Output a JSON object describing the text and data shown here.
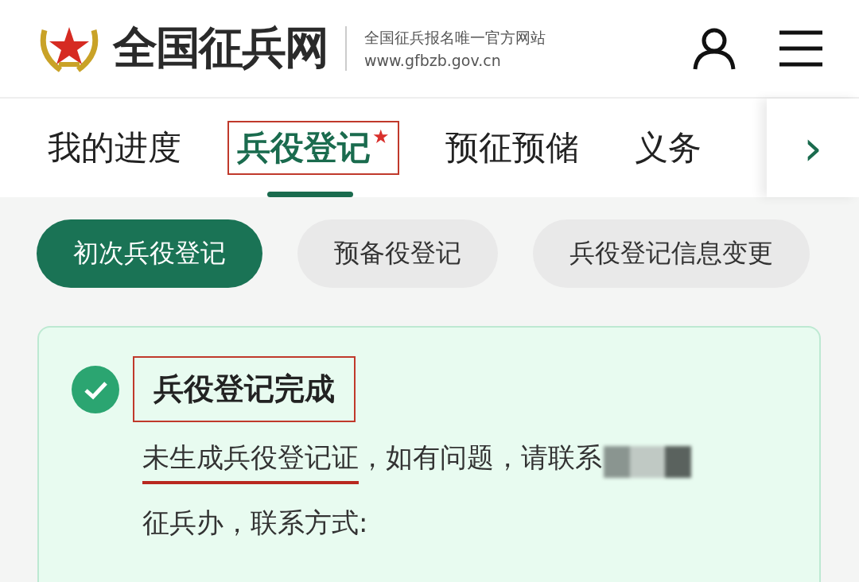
{
  "header": {
    "site_name": "全国征兵网",
    "tagline": "全国征兵报名唯一官方网站",
    "url": "www.gfbzb.gov.cn"
  },
  "tabs": [
    {
      "label": "我的进度",
      "selected": false,
      "starred": false,
      "annotated": false
    },
    {
      "label": "兵役登记",
      "selected": true,
      "starred": true,
      "annotated": true
    },
    {
      "label": "预征预储",
      "selected": false,
      "starred": false,
      "annotated": false
    },
    {
      "label": "义务",
      "selected": false,
      "starred": false,
      "annotated": false
    }
  ],
  "tab_star": "★",
  "tab_more": "›",
  "sub_tabs": [
    {
      "label": "初次兵役登记",
      "selected": true
    },
    {
      "label": "预备役登记",
      "selected": false
    },
    {
      "label": "兵役登记信息变更",
      "selected": false
    }
  ],
  "status_card": {
    "title": "兵役登记完成",
    "title_annotated": true,
    "lines": [
      {
        "parts": [
          {
            "text": "未生成兵役登记证",
            "underlined": true
          },
          {
            "text": "，如有问题，请联系",
            "underlined": false
          }
        ],
        "redacted": true
      },
      {
        "parts": [
          {
            "text": "征兵办，联系方式:",
            "underlined": false
          }
        ],
        "redacted": false
      }
    ]
  }
}
